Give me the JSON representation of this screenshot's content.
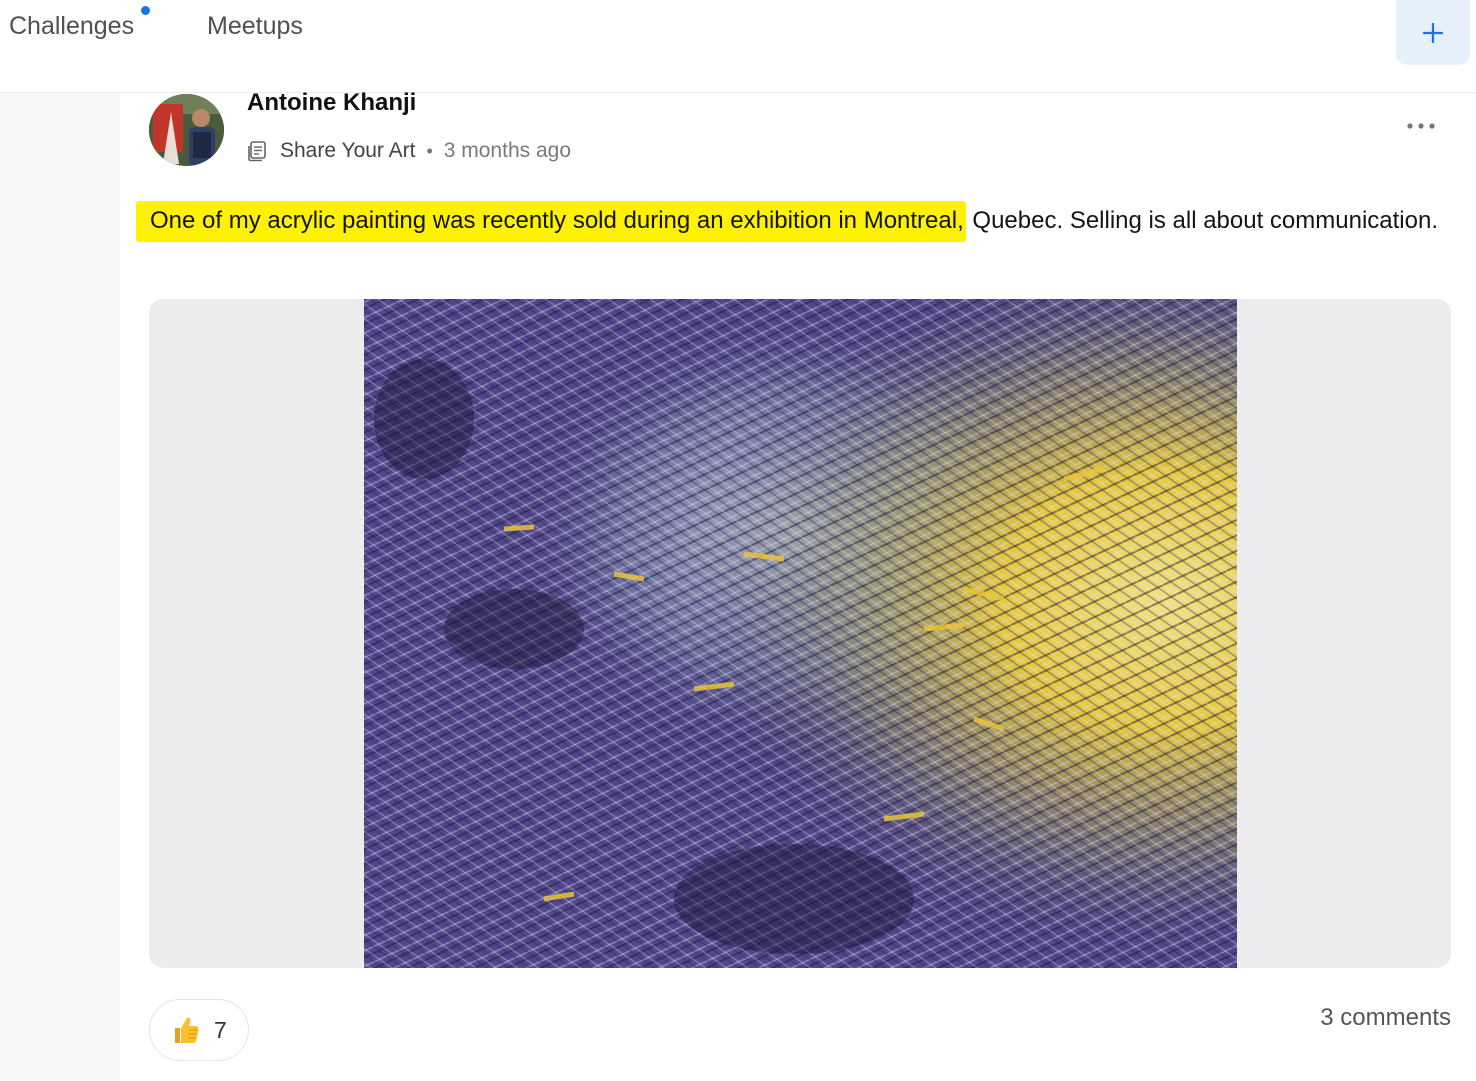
{
  "nav": {
    "tabs": [
      {
        "label": "Challenges",
        "has_notification_dot": true
      },
      {
        "label": "Meetups"
      }
    ],
    "add_icon": "plus-icon",
    "accent_color": "#1a73e8"
  },
  "post": {
    "author": {
      "name": "Antoine Khanji",
      "avatar_icon": "avatar"
    },
    "category_icon": "document-icon",
    "category": "Share Your Art",
    "separator": "•",
    "timestamp": "3 months ago",
    "more_icon": "more-horizontal-icon",
    "text_highlighted": "One of my acrylic painting was recently sold during an exhibition in Montreal,",
    "text_rest": " Quebec. Selling is all about communication.",
    "highlight_color": "#fff200",
    "image_icon": "acrylic-painting-image",
    "likes": {
      "icon": "thumbs-up-icon",
      "count": "7"
    },
    "comments_label": "3 comments"
  }
}
